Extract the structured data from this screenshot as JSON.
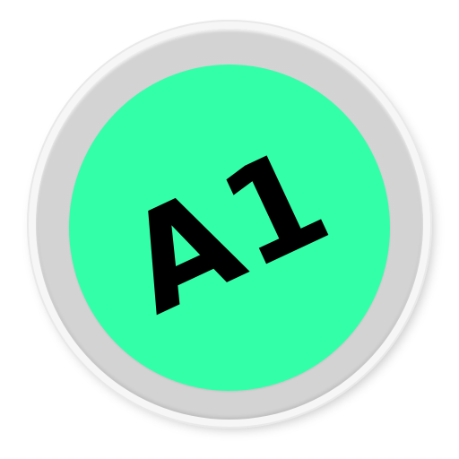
{
  "badge": {
    "text": "A1",
    "colors": {
      "disc": "#33ffa9",
      "ring": "#d3d3d3",
      "rim": "#f6f6f6",
      "text": "#000000"
    }
  }
}
